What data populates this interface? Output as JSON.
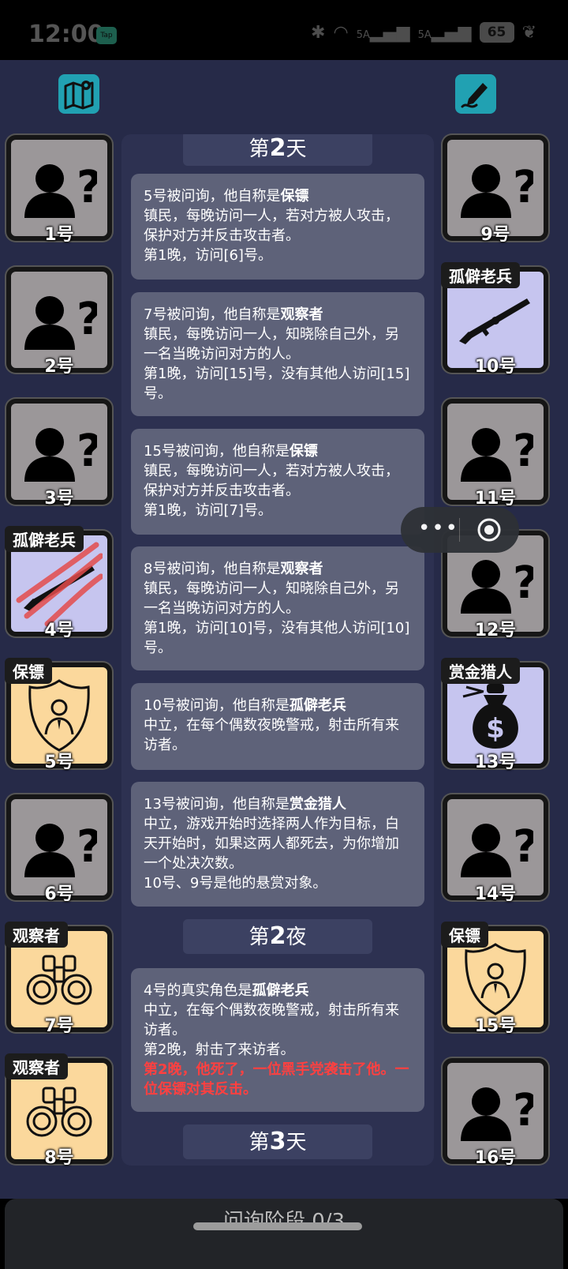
{
  "status_bar": {
    "time": "12:00",
    "app_badge": "Tap",
    "network_1": "5A",
    "network_2": "5A",
    "battery": "65"
  },
  "top": {
    "map_icon": "map-icon",
    "note_icon": "pen-note-icon"
  },
  "players_left": [
    {
      "num": "1号",
      "role": "",
      "type": "unknown"
    },
    {
      "num": "2号",
      "role": "",
      "type": "unknown"
    },
    {
      "num": "3号",
      "role": "",
      "type": "unknown"
    },
    {
      "num": "4号",
      "role": "孤僻老兵",
      "type": "veteran-dead"
    },
    {
      "num": "5号",
      "role": "保镖",
      "type": "bodyguard"
    },
    {
      "num": "6号",
      "role": "",
      "type": "unknown"
    },
    {
      "num": "7号",
      "role": "观察者",
      "type": "observer"
    },
    {
      "num": "8号",
      "role": "观察者",
      "type": "observer"
    }
  ],
  "players_right": [
    {
      "num": "9号",
      "role": "",
      "type": "unknown"
    },
    {
      "num": "10号",
      "role": "孤僻老兵",
      "type": "veteran"
    },
    {
      "num": "11号",
      "role": "",
      "type": "unknown"
    },
    {
      "num": "12号",
      "role": "",
      "type": "unknown"
    },
    {
      "num": "13号",
      "role": "赏金猎人",
      "type": "bounty"
    },
    {
      "num": "14号",
      "role": "",
      "type": "unknown"
    },
    {
      "num": "15号",
      "role": "保镖",
      "type": "bodyguard"
    },
    {
      "num": "16号",
      "role": "",
      "type": "unknown"
    }
  ],
  "log": {
    "day2_prefix": "第",
    "day2_num": "2",
    "day2_suffix": "天",
    "m1": {
      "a": "5号被问询，他自称是",
      "b": "保镖",
      "c": "镇民，每晚访问一人，若对方被人攻击，保护对方并反击攻击者。",
      "d": "第1晚，访问[6]号。"
    },
    "m2": {
      "a": "7号被问询，他自称是",
      "b": "观察者",
      "c": "镇民，每晚访问一人，知晓除自己外，另一名当晚访问对方的人。",
      "d": "第1晚，访问[15]号，没有其他人访问[15]号。"
    },
    "m3": {
      "a": "15号被问询，他自称是",
      "b": "保镖",
      "c": "镇民，每晚访问一人，若对方被人攻击，保护对方并反击攻击者。",
      "d": "第1晚，访问[7]号。"
    },
    "m4": {
      "a": "8号被问询，他自称是",
      "b": "观察者",
      "c": "镇民，每晚访问一人，知晓除自己外，另一名当晚访问对方的人。",
      "d": "第1晚，访问[10]号，没有其他人访问[10]号。"
    },
    "m5": {
      "a": "10号被问询，他自称是",
      "b": "孤僻老兵",
      "c": "中立，在每个偶数夜晚警戒，射击所有来访者。"
    },
    "m6": {
      "a": "13号被问询，他自称是",
      "b": "赏金猎人",
      "c": "中立，游戏开始时选择两人作为目标，白天开始时，如果这两人都死去，为你增加一个处决次数。",
      "d": "10号、9号是他的悬赏对象。"
    },
    "night2_prefix": "第",
    "night2_num": "2",
    "night2_suffix": "夜",
    "m7": {
      "a": "4号的真实角色是",
      "b": "孤僻老兵",
      "c": "中立，在每个偶数夜晚警戒，射击所有来访者。",
      "d": "第2晚，射击了来访者。",
      "e": "第2晚，他死了，一位黑手党袭击了他。一位保镖对其反击。"
    },
    "day3_prefix": "第",
    "day3_num": "3",
    "day3_suffix": "天"
  },
  "bottom": {
    "phase": "问询阶段 0/3"
  },
  "colors": {
    "background": "#262a48",
    "unknown_card": "#9b9799",
    "town_card": "#fbd89c",
    "neutral_card": "#c6c5ef",
    "accent": "#21a1b2",
    "alert_red": "#ff4040"
  }
}
